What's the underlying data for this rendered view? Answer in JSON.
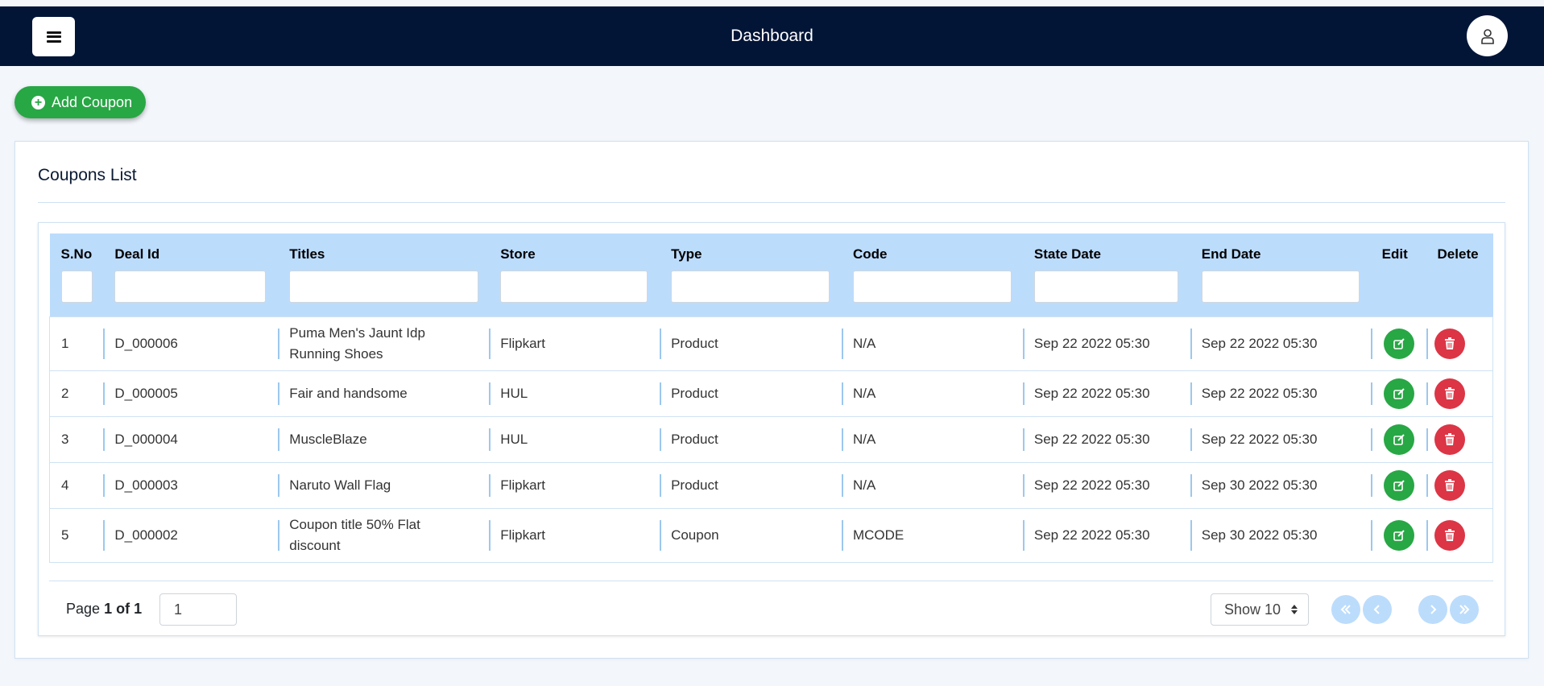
{
  "navbar": {
    "title": "Dashboard"
  },
  "actions": {
    "add_label": "Add Coupon"
  },
  "card": {
    "title": "Coupons List"
  },
  "table": {
    "headers": [
      "S.No",
      "Deal Id",
      "Titles",
      "Store",
      "Type",
      "Code",
      "State Date",
      "End Date",
      "Edit",
      "Delete"
    ],
    "rows": [
      [
        "1",
        "D_000006",
        "Puma Men's Jaunt Idp Running Shoes",
        "Flipkart",
        "Product",
        "N/A",
        "Sep 22 2022 05:30",
        "Sep 22 2022 05:30"
      ],
      [
        "2",
        "D_000005",
        "Fair and handsome",
        "HUL",
        "Product",
        "N/A",
        "Sep 22 2022 05:30",
        "Sep 22 2022 05:30"
      ],
      [
        "3",
        "D_000004",
        "MuscleBlaze",
        "HUL",
        "Product",
        "N/A",
        "Sep 22 2022 05:30",
        "Sep 22 2022 05:30"
      ],
      [
        "4",
        "D_000003",
        "Naruto Wall Flag",
        "Flipkart",
        "Product",
        "N/A",
        "Sep 22 2022 05:30",
        "Sep 30 2022 05:30"
      ],
      [
        "5",
        "D_000002",
        "Coupon title 50% Flat discount",
        "Flipkart",
        "Coupon",
        "MCODE",
        "Sep 22 2022 05:30",
        "Sep 30 2022 05:30"
      ]
    ]
  },
  "pagination": {
    "page_prefix": "Page",
    "page_current_of_total": "1 of 1",
    "page_input_value": "1",
    "show_label": "Show 10"
  },
  "icons": {
    "menu": "menu-icon",
    "user": "user-icon",
    "add": "plus-circle-icon",
    "edit": "edit-icon",
    "delete": "trash-icon"
  },
  "colors": {
    "navbar": "#021537",
    "success": "#28a745",
    "danger": "#dc3545",
    "table_header": "#bcdcfc"
  }
}
